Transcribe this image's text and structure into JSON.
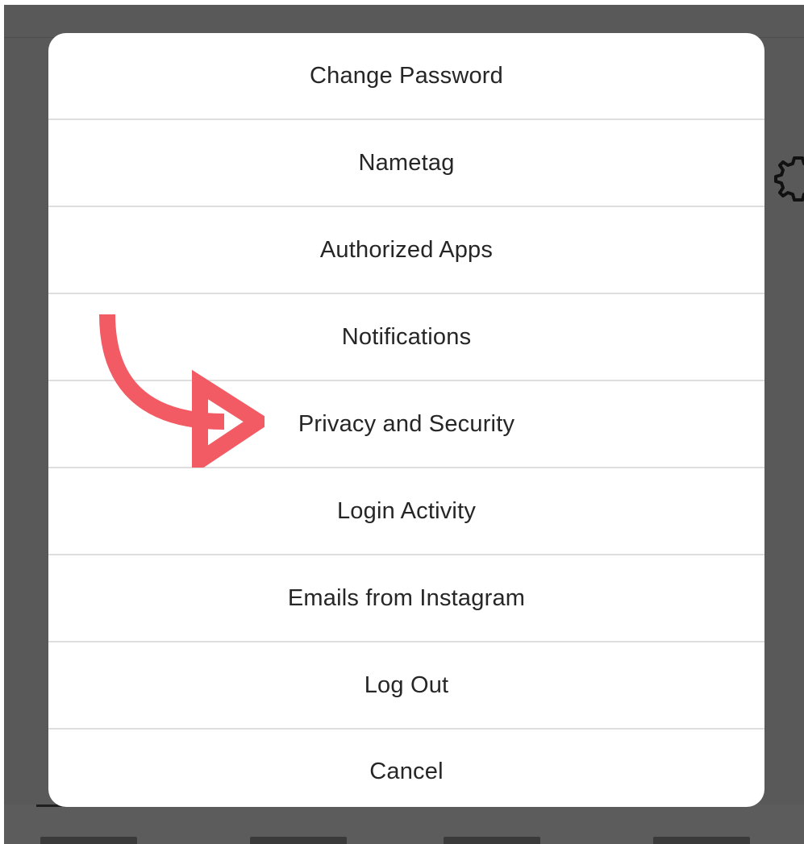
{
  "menu": {
    "items": [
      {
        "label": "Change Password"
      },
      {
        "label": "Nametag"
      },
      {
        "label": "Authorized Apps"
      },
      {
        "label": "Notifications"
      },
      {
        "label": "Privacy and Security"
      },
      {
        "label": "Login Activity"
      },
      {
        "label": "Emails from Instagram"
      },
      {
        "label": "Log Out"
      },
      {
        "label": "Cancel"
      }
    ]
  },
  "annotation": {
    "icon": "curved-arrow-icon",
    "color": "#f25b63",
    "target": "Privacy and Security"
  },
  "background": {
    "overlay_color": "#595959",
    "icons": [
      "gear-icon"
    ]
  }
}
